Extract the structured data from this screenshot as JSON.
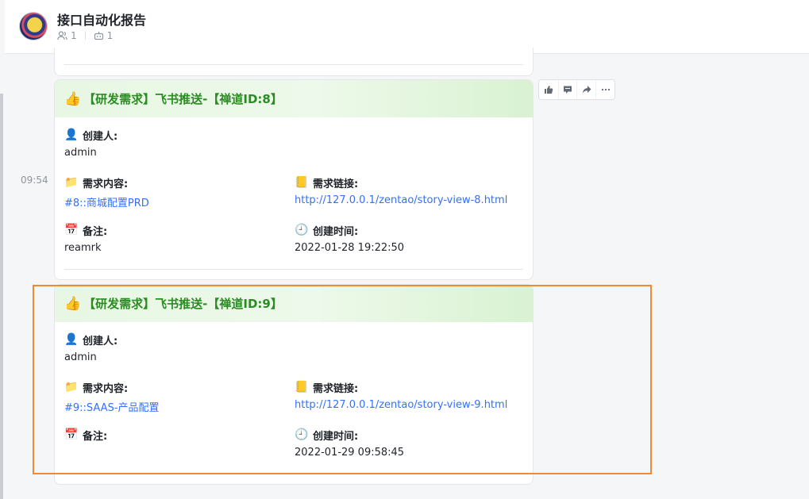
{
  "header": {
    "title": "接口自动化报告",
    "members_count": "1",
    "bots_count": "1"
  },
  "message": {
    "time": "09:54"
  },
  "cards": [
    {
      "title": "【研发需求】飞书推送-【禅道ID:8】",
      "creator_label": "创建人:",
      "creator": "admin",
      "content_label": "需求内容:",
      "content": "#8::商城配置PRD",
      "link_label": "需求链接:",
      "link": "http://127.0.0.1/zentao/story-view-8.html",
      "note_label": "备注:",
      "note": "reamrk",
      "created_label": "创建时间:",
      "created": "2022-01-28 19:22:50"
    },
    {
      "title": "【研发需求】飞书推送-【禅道ID:9】",
      "creator_label": "创建人:",
      "creator": "admin",
      "content_label": "需求内容:",
      "content": "#9::SAAS-产品配置",
      "link_label": "需求链接:",
      "link": "http://127.0.0.1/zentao/story-view-9.html",
      "note_label": "备注:",
      "note": "",
      "created_label": "创建时间:",
      "created": "2022-01-29 09:58:45"
    }
  ],
  "icons": {
    "thumbs_up": "thumbs-up-icon",
    "creator": "person-icon",
    "content": "folder-icon",
    "link": "ledger-icon",
    "note": "calendar-icon",
    "created": "clock-icon"
  },
  "colors": {
    "card_title": "#2a8c22",
    "link": "#3370ff",
    "highlight": "#f08a35"
  }
}
